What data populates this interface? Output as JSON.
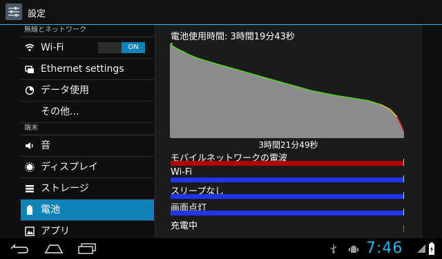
{
  "app": {
    "title": "設定",
    "icon": "settings-icon"
  },
  "sidebar": {
    "sections": [
      {
        "header": "無線とネットワーク",
        "items": [
          {
            "label": "Wi-Fi",
            "icon": "wifi-icon",
            "toggle": "ON"
          },
          {
            "label": "Ethernet settings",
            "icon": "ethernet-icon"
          },
          {
            "label": "データ使用",
            "icon": "data-usage-icon"
          },
          {
            "label": "その他...",
            "icon": ""
          }
        ]
      },
      {
        "header": "端末",
        "items": [
          {
            "label": "音",
            "icon": "sound-icon"
          },
          {
            "label": "ディスプレイ",
            "icon": "display-icon"
          },
          {
            "label": "ストレージ",
            "icon": "storage-icon"
          },
          {
            "label": "電池",
            "icon": "battery-icon",
            "selected": true
          },
          {
            "label": "アプリ",
            "icon": "apps-icon"
          }
        ]
      }
    ]
  },
  "battery": {
    "usage_time": "電池使用時間: 3時間19分43秒",
    "duration_label": "3時間21分49秒",
    "stats": [
      {
        "label": "モバイルネットワークの電波",
        "color": "#b30000",
        "fill": 1.0
      },
      {
        "label": "Wi-Fi",
        "color": "#1f35e8",
        "fill": 1.0
      },
      {
        "label": "スリープなし",
        "color": "#1f35e8",
        "fill": 1.0
      },
      {
        "label": "画面点灯",
        "color": "#1f35e8",
        "fill": 1.0
      },
      {
        "label": "充電中",
        "color": "#2db52d",
        "fill": 0.0
      }
    ]
  },
  "chart_data": {
    "type": "area",
    "x_unit": "fraction_of_duration",
    "y_unit": "battery_fraction",
    "points": [
      [
        0.0,
        1.0
      ],
      [
        0.01,
        0.97
      ],
      [
        0.04,
        0.93
      ],
      [
        0.08,
        0.88
      ],
      [
        0.12,
        0.84
      ],
      [
        0.2,
        0.78
      ],
      [
        0.3,
        0.71
      ],
      [
        0.4,
        0.64
      ],
      [
        0.5,
        0.57
      ],
      [
        0.6,
        0.5
      ],
      [
        0.7,
        0.45
      ],
      [
        0.75,
        0.43
      ],
      [
        0.8,
        0.41
      ],
      [
        0.85,
        0.39
      ],
      [
        0.9,
        0.35
      ],
      [
        0.94,
        0.3
      ],
      [
        0.97,
        0.22
      ],
      [
        0.99,
        0.12
      ],
      [
        1.0,
        0.06
      ]
    ],
    "line_colors": {
      "high": "#55d122",
      "mid": "#d6c11d",
      "low": "#e02020"
    },
    "area_color": "#8c8c8c",
    "axis_color": "#ffffff"
  },
  "status_bar": {
    "time": "7:46"
  },
  "nav": {
    "back": "back-icon",
    "home": "home-icon",
    "recents": "recents-icon"
  }
}
